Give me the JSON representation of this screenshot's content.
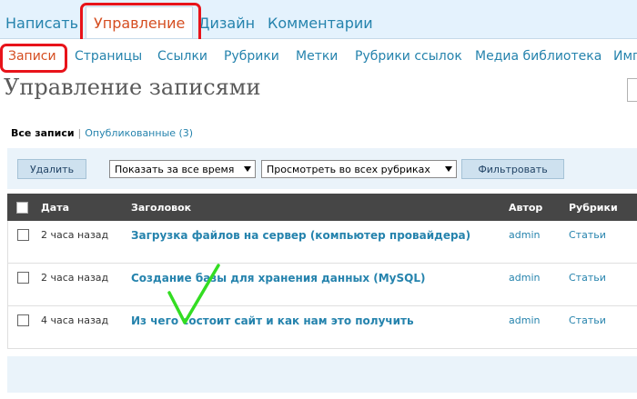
{
  "top_menu": {
    "items": [
      "Написать",
      "Управление",
      "Дизайн",
      "Комментарии"
    ]
  },
  "sub_menu": {
    "items": [
      "Записи",
      "Страницы",
      "Ссылки",
      "Рубрики",
      "Метки",
      "Рубрики ссылок",
      "Медиа библиотека",
      "Имп"
    ]
  },
  "page": {
    "title": "Управление записями"
  },
  "filters": {
    "current": "Все записи",
    "published": "Опубликованные (3)"
  },
  "actions": {
    "delete_label": "Удалить",
    "date_select": "Показать за все время",
    "category_select": "Просмотреть во всех рубриках",
    "filter_label": "Фильтровать"
  },
  "table": {
    "columns": [
      "Дата",
      "Заголовок",
      "Автор",
      "Рубрики"
    ],
    "rows": [
      {
        "date": "2 часа назад",
        "title": "Загрузка файлов на сервер (компьютер провайдера)",
        "author": "admin",
        "category": "Статьи"
      },
      {
        "date": "2 часа назад",
        "title": "Создание базы для хранения данных (MySQL)",
        "author": "admin",
        "category": "Статьи"
      },
      {
        "date": "4 часа назад",
        "title": "Из чего состоит сайт и как нам это получить",
        "author": "admin",
        "category": "Статьи"
      }
    ]
  },
  "colors": {
    "link": "#2583ad",
    "active": "#d54e21",
    "highlight": "#e8131a",
    "checkmark": "#33dd22"
  }
}
